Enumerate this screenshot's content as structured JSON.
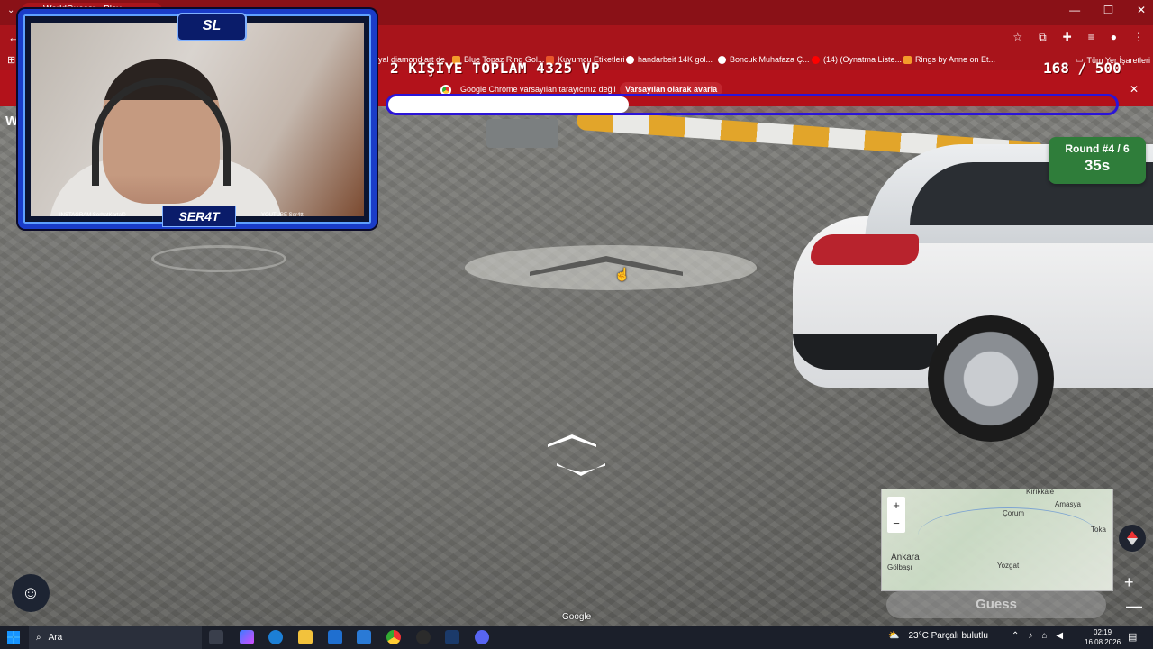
{
  "browser": {
    "tab_title": "WorldGuessr - Play Geoguessr",
    "bookmarks": [
      "yal diamond art de",
      "Blue Topaz Ring Gol...",
      "Kuyumcu Etiketleri",
      "handarbeit 14K gol...",
      "Boncuk Muhafaza Ç...",
      "(14) (Oynatma Liste...",
      "Rings by Anne on Et...",
      "Tüm Yer İşaretleri"
    ],
    "infobar_message": "Google Chrome varsayılan tarayıcınız değil",
    "infobar_button": "Varsayılan olarak avarla",
    "infobar_close": "✕"
  },
  "overlay": {
    "title": "2 KİŞİYE TOPLAM 4325 VP",
    "count": "168 / 500",
    "progress": 0.33
  },
  "page_letter": "W",
  "webcam": {
    "logo": "SL",
    "brand": "SER4T",
    "instagram": "INSTAGRAM SerhatKartal0",
    "youtube": "YOUTUBE Ser4tt"
  },
  "game": {
    "round_label": "Round #4 / 6",
    "timer": "35s",
    "guess_button": "Guess",
    "watermark": "Google",
    "map_cities": [
      "Amasya",
      "Çorum",
      "Toka",
      "Ankara",
      "Gölbaşı",
      "Yozgat",
      "Kırıkkale"
    ],
    "map_zoom_in": "+",
    "map_zoom_out": "−"
  },
  "taskbar": {
    "search_placeholder": "Ara",
    "weather": "23°C  Parçalı bulutlu",
    "time": "02:19",
    "date": "16.08.2026"
  },
  "colors": {
    "browser_red": "#a8141b",
    "round_green": "#2f7d3a",
    "progress_border": "#2b14d8"
  }
}
